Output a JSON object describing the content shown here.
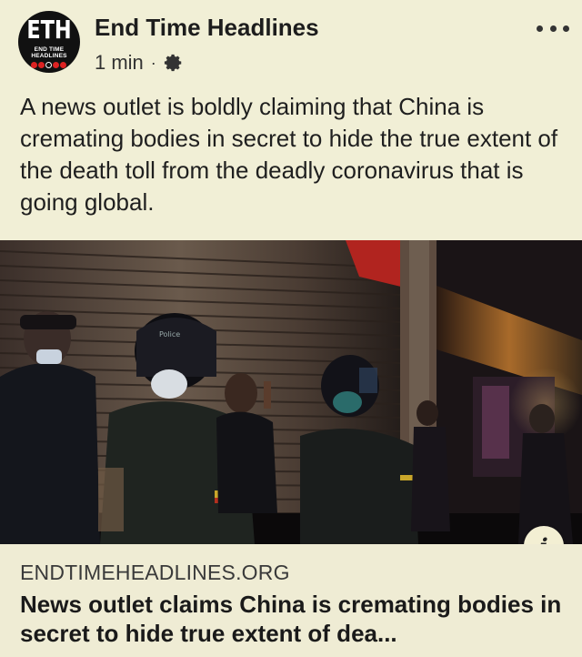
{
  "post": {
    "author": "End Time Headlines",
    "timestamp": "1 min",
    "separator": "·",
    "privacy_icon": "gear-icon",
    "more_icon": "more-icon",
    "text": "A news outlet is boldly claiming that China is cremating bodies in secret to hide the true extent of the death toll from the deadly coronavirus that is going global."
  },
  "avatar": {
    "logo_letters": "ETH",
    "logo_subtext": "END TIME HEADLINES"
  },
  "photo": {
    "helmet_text": "Police"
  },
  "link_preview": {
    "domain": "ENDTIMEHEADLINES.ORG",
    "title": "News outlet claims China is cremating bodies in secret to hide true extent of dea...",
    "info_icon": "i"
  },
  "colors": {
    "background": "#f1efd6",
    "text": "#1c1c1c",
    "accent_red": "#d22222"
  }
}
